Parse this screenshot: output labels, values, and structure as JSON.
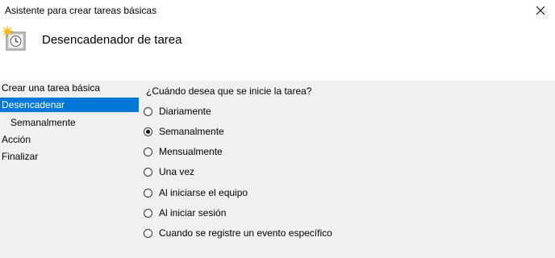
{
  "window": {
    "title": "Asistente para crear tareas básicas"
  },
  "header": {
    "title": "Desencadenador de tarea",
    "icon": "task-scheduler-clock-icon"
  },
  "nav": {
    "items": [
      {
        "label": "Crear una tarea básica",
        "selected": false,
        "sub": false
      },
      {
        "label": "Desencadenar",
        "selected": true,
        "sub": false
      },
      {
        "label": "Semanalmente",
        "selected": false,
        "sub": true
      },
      {
        "label": "Acción",
        "selected": false,
        "sub": false
      },
      {
        "label": "Finalizar",
        "selected": false,
        "sub": false
      }
    ]
  },
  "main": {
    "question": "¿Cuándo desea que se inicie la tarea?",
    "selected_index": 1,
    "options": [
      "Diariamente",
      "Semanalmente",
      "Mensualmente",
      "Una vez",
      "Al iniciarse el equipo",
      "Al iniciar sesión",
      "Cuando se registre un evento específico"
    ]
  },
  "colors": {
    "selection": "#0078d7",
    "content_bg": "#f0f0f0"
  }
}
